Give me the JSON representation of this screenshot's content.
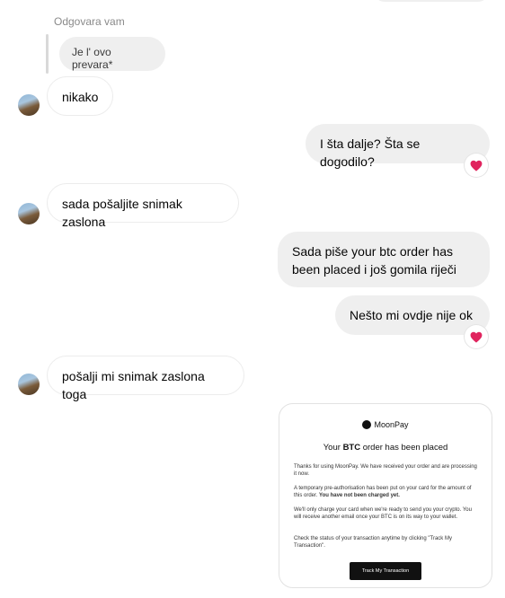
{
  "reply": {
    "label": "Odgovara vam",
    "quoted": "Je l' ovo prevara*"
  },
  "messages": [
    {
      "text": "nikako"
    },
    {
      "text": "I šta dalje? Šta se dogodilo?"
    },
    {
      "text": "sada pošaljite snimak zaslona"
    },
    {
      "text": "Sada piše your btc order has been placed i još gomila riječi"
    },
    {
      "text": "Nešto mi ovdje nije ok"
    },
    {
      "text": "pošalji mi snimak zaslona toga"
    }
  ],
  "reaction": "heart",
  "screenshot": {
    "brand": "MoonPay",
    "title_pre": "Your ",
    "title_bold": "BTC",
    "title_post": " order has been placed",
    "p1": "Thanks for using MoonPay. We have received your order and are processing it now.",
    "p2a": "A temporary pre-authorisation has been put on your card for the amount of this order. ",
    "p2b": "You have not been charged yet.",
    "p3": "We'll only charge your card when we're ready to send you your crypto. You will receive another email once your BTC is on its way to your wallet.",
    "p4": "Check the status of your transaction anytime by clicking \"Track My Transaction\".",
    "button": "Track My Transaction"
  },
  "colors": {
    "heart": "#e0245e",
    "outgoing_bubble": "#efefef",
    "incoming_border": "#ececec"
  }
}
